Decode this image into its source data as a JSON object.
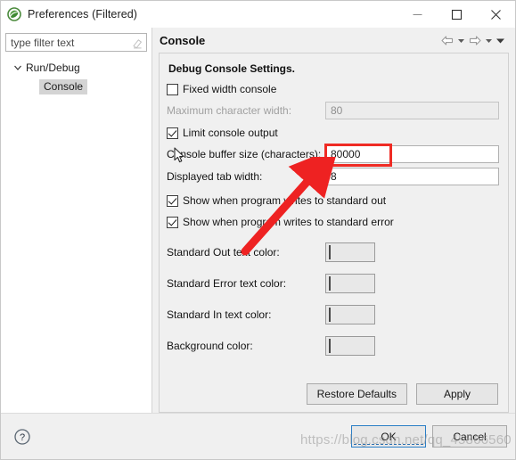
{
  "window": {
    "title": "Preferences (Filtered)",
    "icon": "eclipse-logo-icon",
    "minimize_label": "—",
    "maximize_label": "☐",
    "close_label": "✕"
  },
  "sidebar": {
    "filter": {
      "value": "",
      "placeholder": "type filter text",
      "clear_icon": "eraser-icon"
    },
    "tree": [
      {
        "label": "Run/Debug",
        "expanded": true,
        "selected": false
      },
      {
        "label": "Console",
        "expanded": false,
        "selected": true
      }
    ]
  },
  "page": {
    "title": "Console",
    "nav": {
      "back_icon": "arrow-left-icon",
      "back_menu_icon": "chevron-down-icon",
      "forward_icon": "arrow-right-icon",
      "forward_menu_icon": "chevron-down-icon",
      "view_menu_icon": "chevron-down-icon"
    },
    "section_title": "Debug Console Settings.",
    "fields": {
      "fixed_width_console": {
        "label": "Fixed width console",
        "checked": false
      },
      "maximum_character_width": {
        "label": "Maximum character width:",
        "value": "80",
        "disabled": true
      },
      "limit_console_output": {
        "label": "Limit console output",
        "checked": true
      },
      "console_buffer_size": {
        "label": "Console buffer size (characters):",
        "value": "80000",
        "disabled": false,
        "highlighted": true
      },
      "displayed_tab_width": {
        "label": "Displayed tab width:",
        "value": "8",
        "disabled": false
      },
      "show_standard_out": {
        "label": "Show when program writes to standard out",
        "checked": true
      },
      "show_standard_error": {
        "label": "Show when program writes to standard error",
        "checked": true
      }
    },
    "colors": [
      {
        "label": "Standard Out text color:",
        "value": "#000000"
      },
      {
        "label": "Standard Error text color:",
        "value": "#ee1111"
      },
      {
        "label": "Standard In text color:",
        "value": "#0a8a4e"
      },
      {
        "label": "Background color:",
        "value": "#ffffff"
      }
    ],
    "buttons": {
      "restore_defaults": "Restore Defaults",
      "apply": "Apply"
    }
  },
  "footer": {
    "help_icon": "help-circle-icon",
    "ok": "OK",
    "cancel": "Cancel"
  },
  "annotations": {
    "highlight_color": "#ef2b24",
    "arrow_color": "#ee2222",
    "cursor_icon": "mouse-pointer-icon"
  },
  "watermark": {
    "text": "https://blog.csdn.net/qq_45866560"
  }
}
